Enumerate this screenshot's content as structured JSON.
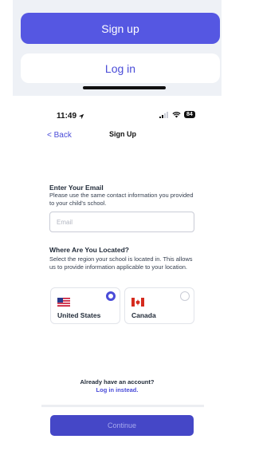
{
  "top": {
    "signup_label": "Sign up",
    "login_label": "Log in"
  },
  "status": {
    "time": "11:49",
    "battery": "84"
  },
  "nav": {
    "back_label": "< Back",
    "title": "Sign Up"
  },
  "email": {
    "title": "Enter Your Email",
    "description": "Please use the same contact information you provided to your child's school.",
    "placeholder": "Email",
    "value": ""
  },
  "location": {
    "title": "Where Are You Located?",
    "description": "Select the region your school is located in. This allows us to provide information applicable to your location.",
    "options": [
      {
        "label": "United States",
        "selected": true
      },
      {
        "label": "Canada",
        "selected": false
      }
    ]
  },
  "footer": {
    "already_text": "Already have an account?",
    "login_link": "Log in instead.",
    "continue_label": "Continue"
  },
  "colors": {
    "accent": "#4a4cd8",
    "button_primary": "#5557e2",
    "continue_bg": "#4547c7"
  }
}
